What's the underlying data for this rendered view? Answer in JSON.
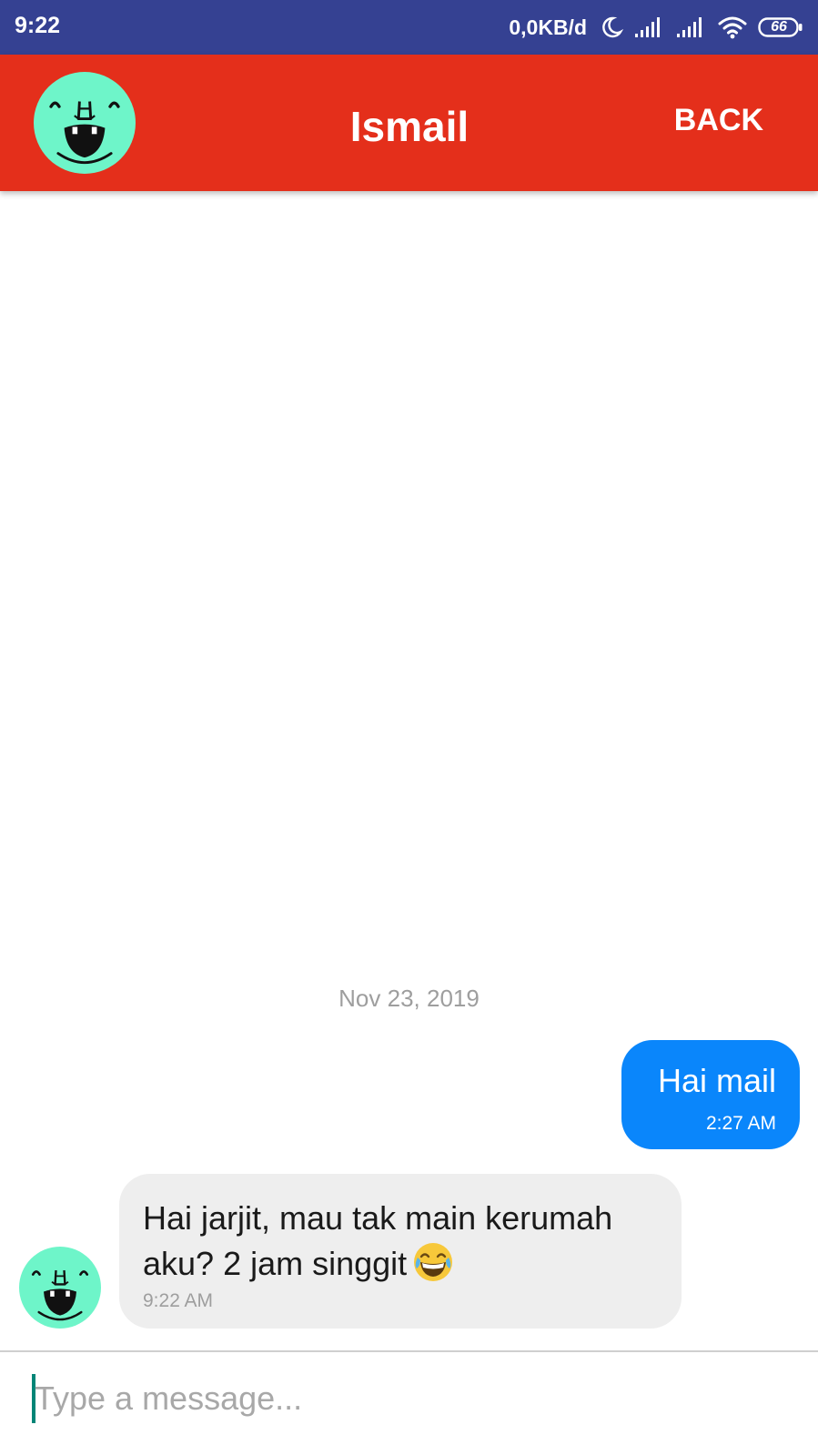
{
  "status_bar": {
    "time": "9:22",
    "network_speed": "0,0KB/d",
    "battery": "66",
    "icons": [
      "moon-icon",
      "signal-icon",
      "signal-icon",
      "wifi-icon",
      "battery-icon"
    ]
  },
  "header": {
    "title": "Ismail",
    "back_label": "BACK",
    "avatar_icon": "laughing-face-avatar"
  },
  "chat": {
    "date_divider": "Nov 23, 2019",
    "messages": [
      {
        "direction": "outgoing",
        "text": "Hai mail",
        "time": "2:27 AM"
      },
      {
        "direction": "incoming",
        "text": "Hai jarjit, mau tak main kerumah aku? 2 jam singgit",
        "emoji": "tears-of-joy-emoji",
        "time": "9:22 AM"
      }
    ]
  },
  "composer": {
    "placeholder": "Type a message...",
    "value": ""
  },
  "colors": {
    "status_bar": "#354192",
    "app_bar": "#e42f1b",
    "avatar_bg": "#6ef5c9",
    "outgoing_bubble": "#0a86fb",
    "incoming_bubble": "#eeeeee",
    "cursor": "#008577"
  }
}
